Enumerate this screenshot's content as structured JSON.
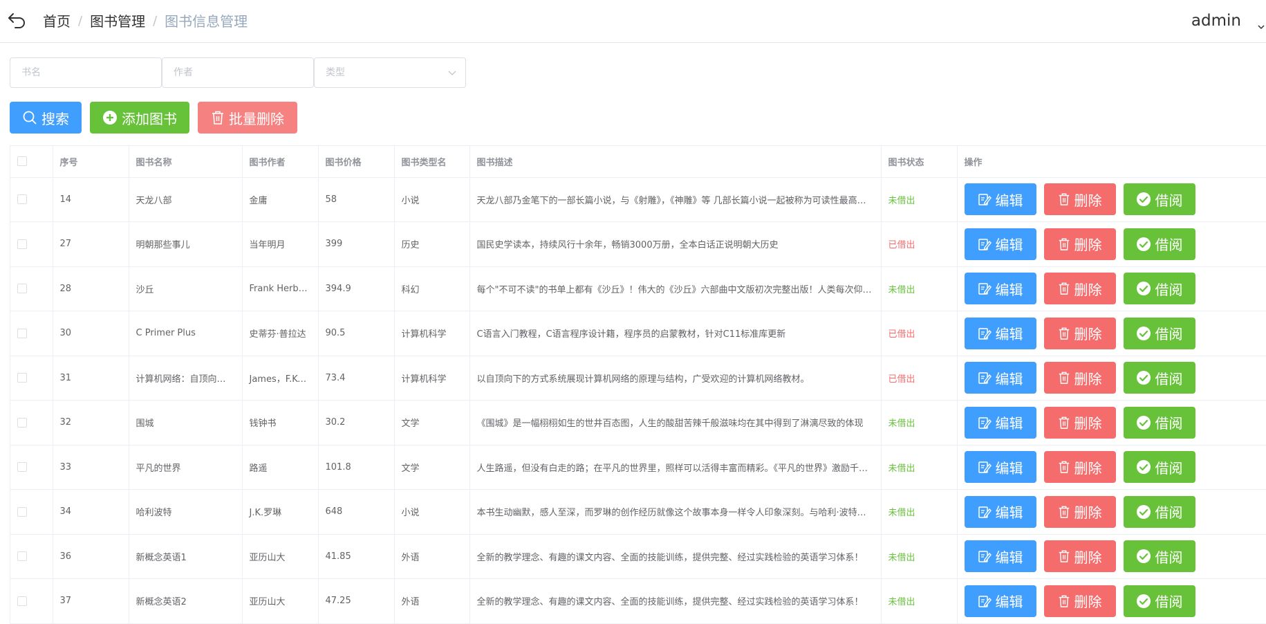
{
  "header": {
    "breadcrumbs": [
      "首页",
      "图书管理",
      "图书信息管理"
    ],
    "user": "admin"
  },
  "filters": {
    "name_placeholder": "书名",
    "author_placeholder": "作者",
    "type_placeholder": "类型"
  },
  "toolbar": {
    "search_label": "搜索",
    "add_label": "添加图书",
    "batch_delete_label": "批量删除"
  },
  "table": {
    "columns": [
      "序号",
      "图书名称",
      "图书作者",
      "图书价格",
      "图书类型名",
      "图书描述",
      "图书状态",
      "操作"
    ],
    "ops": {
      "edit": "编辑",
      "delete": "删除",
      "borrow": "借阅"
    },
    "rows": [
      {
        "id": "14",
        "name": "天龙八部",
        "author": "金庸",
        "price": "58",
        "type": "小说",
        "desc": "天龙八部乃金笔下的一部长篇小说，与《射雕》，《神雕》等 几部长篇小说一起被称为可读性最高的金庸小说",
        "status": "未借出"
      },
      {
        "id": "27",
        "name": "明朝那些事儿",
        "author": "当年明月",
        "price": "399",
        "type": "历史",
        "desc": "国民史学读本，持续风行十余年，畅销3000万册，全本白话正说明朝大历史",
        "status": "已借出"
      },
      {
        "id": "28",
        "name": "沙丘",
        "author": "Frank Herbert",
        "price": "394.9",
        "type": "科幻",
        "desc": "每个\"不可不读\"的书单上都有《沙丘》！伟大的《沙丘》六部曲中文版初次完整出版！人类每次仰望星空",
        "status": "未借出"
      },
      {
        "id": "30",
        "name": "C Primer Plus",
        "author": "史蒂芬·普拉达",
        "price": "90.5",
        "type": "计算机科学",
        "desc": "C语言入门教程，C语言程序设计籍，程序员的启蒙教材，针对C11标准库更新",
        "status": "已借出"
      },
      {
        "id": "31",
        "name": "计算机网络：自顶向下方法",
        "author": "James，F.Kurose",
        "price": "73.4",
        "type": "计算机科学",
        "desc": "以自顶向下的方式系统展现计算机网络的原理与结构，广受欢迎的计算机网络教材。",
        "status": "已借出"
      },
      {
        "id": "32",
        "name": "围城",
        "author": "钱钟书",
        "price": "30.2",
        "type": "文学",
        "desc": "《围城》是一幅栩栩如生的世井百态图，人生的酸甜苦辣千般滋味均在其中得到了淋漓尽致的体现",
        "status": "未借出"
      },
      {
        "id": "33",
        "name": "平凡的世界",
        "author": "路遥",
        "price": "101.8",
        "type": "文学",
        "desc": "人生路遥，但没有白走的路；在平凡的世界里，照样可以活得丰富而精彩。《平凡的世界》激励千万青年",
        "status": "未借出"
      },
      {
        "id": "34",
        "name": "哈利波特",
        "author": "J.K.罗琳",
        "price": "648",
        "type": "小说",
        "desc": "本书生动幽默，感人至深，而罗琳的创作经历就像这个故事本身一样令人印象深刻。与哈利·波特一起成长",
        "status": "未借出"
      },
      {
        "id": "36",
        "name": "新概念英语1",
        "author": "亚历山大",
        "price": "41.85",
        "type": "外语",
        "desc": "全新的教学理念、有趣的课文内容、全面的技能训练，提供完整、经过实践检验的英语学习体系！",
        "status": "未借出"
      },
      {
        "id": "37",
        "name": "新概念英语2",
        "author": "亚历山大",
        "price": "47.25",
        "type": "外语",
        "desc": "全新的教学理念、有趣的课文内容、全面的技能训练，提供完整、经过实践检验的英语学习体系！",
        "status": "未借出"
      }
    ]
  },
  "colors": {
    "primary": "#409eff",
    "success": "#67c23a",
    "danger": "#f56c6c"
  }
}
